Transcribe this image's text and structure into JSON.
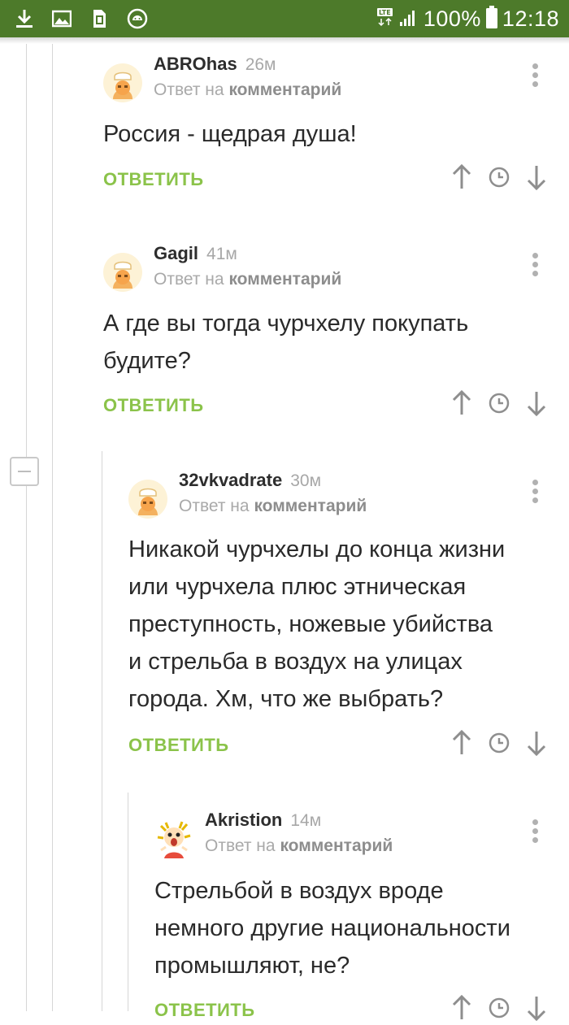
{
  "status_bar": {
    "battery": "100%",
    "time": "12:18",
    "network": "LTE"
  },
  "ui": {
    "answer_label": "ОТВЕТИТЬ",
    "reply_prefix": "Ответ на",
    "reply_target": "комментарий"
  },
  "comments": [
    {
      "author": "ABROhas",
      "time": "26м",
      "lines": [
        "Россия - щедрая душа!"
      ]
    },
    {
      "author": "Gagil",
      "time": "41м",
      "lines": [
        "А где вы тогда чурчхелу покупать",
        "будите?"
      ]
    },
    {
      "author": "32vkvadrate",
      "time": "30м",
      "lines": [
        "Никакой чурчхелы до конца жизни",
        "или чурчхела плюс этническая",
        "преступность, ножевые убийства",
        "и стрельба в воздух на улицах",
        "города. Хм, что же выбрать?"
      ]
    },
    {
      "author": "Akristion",
      "time": "14м",
      "lines": [
        "Стрельбой в воздух вроде",
        "немного другие национальности",
        "промышляют, не?"
      ]
    }
  ],
  "colors": {
    "status_bar": "#4d7a2a",
    "answer_green": "#8bc34a",
    "text": "#2a2a2a",
    "muted": "#a9a9a9"
  }
}
